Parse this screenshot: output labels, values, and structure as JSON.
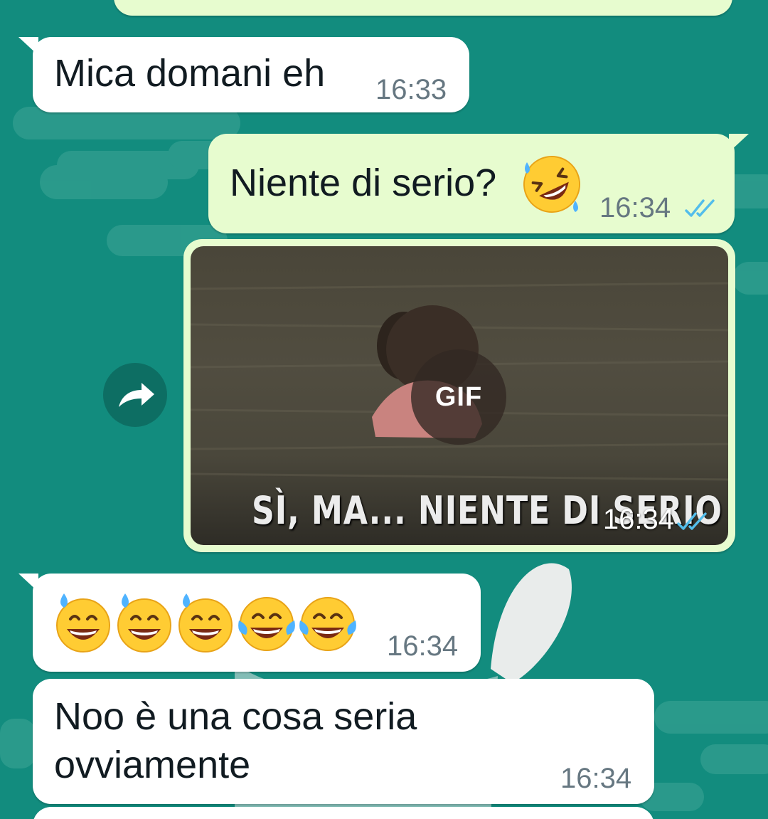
{
  "messages": [
    {
      "direction": "incoming",
      "text": "Mica domani eh",
      "time": "16:33"
    },
    {
      "direction": "outgoing",
      "text": "Niente di serio?",
      "emoji": [
        "rolling-on-floor-laughing"
      ],
      "time": "16:34",
      "status": "read"
    },
    {
      "direction": "outgoing",
      "type": "gif",
      "badge": "GIF",
      "caption": "SÌ, MA... NIENTE DI SERIO",
      "time": "16:34",
      "status": "read"
    },
    {
      "direction": "incoming",
      "emoji": [
        "grinning-face-with-sweat",
        "grinning-face-with-sweat",
        "grinning-face-with-sweat",
        "face-with-tears-of-joy",
        "face-with-tears-of-joy"
      ],
      "time": "16:34"
    },
    {
      "direction": "incoming",
      "lines": [
        "Noo è una cosa seria",
        "ovviamente"
      ],
      "time": "16:34"
    }
  ],
  "colors": {
    "wallpaper": "#128C7E",
    "incoming_bubble": "#ffffff",
    "outgoing_bubble": "#e7fccf",
    "read_ticks": "#53bdeb",
    "timestamp": "#667781"
  },
  "icons": {
    "forward": "forward-arrow-icon",
    "read_status": "double-check-icon"
  }
}
